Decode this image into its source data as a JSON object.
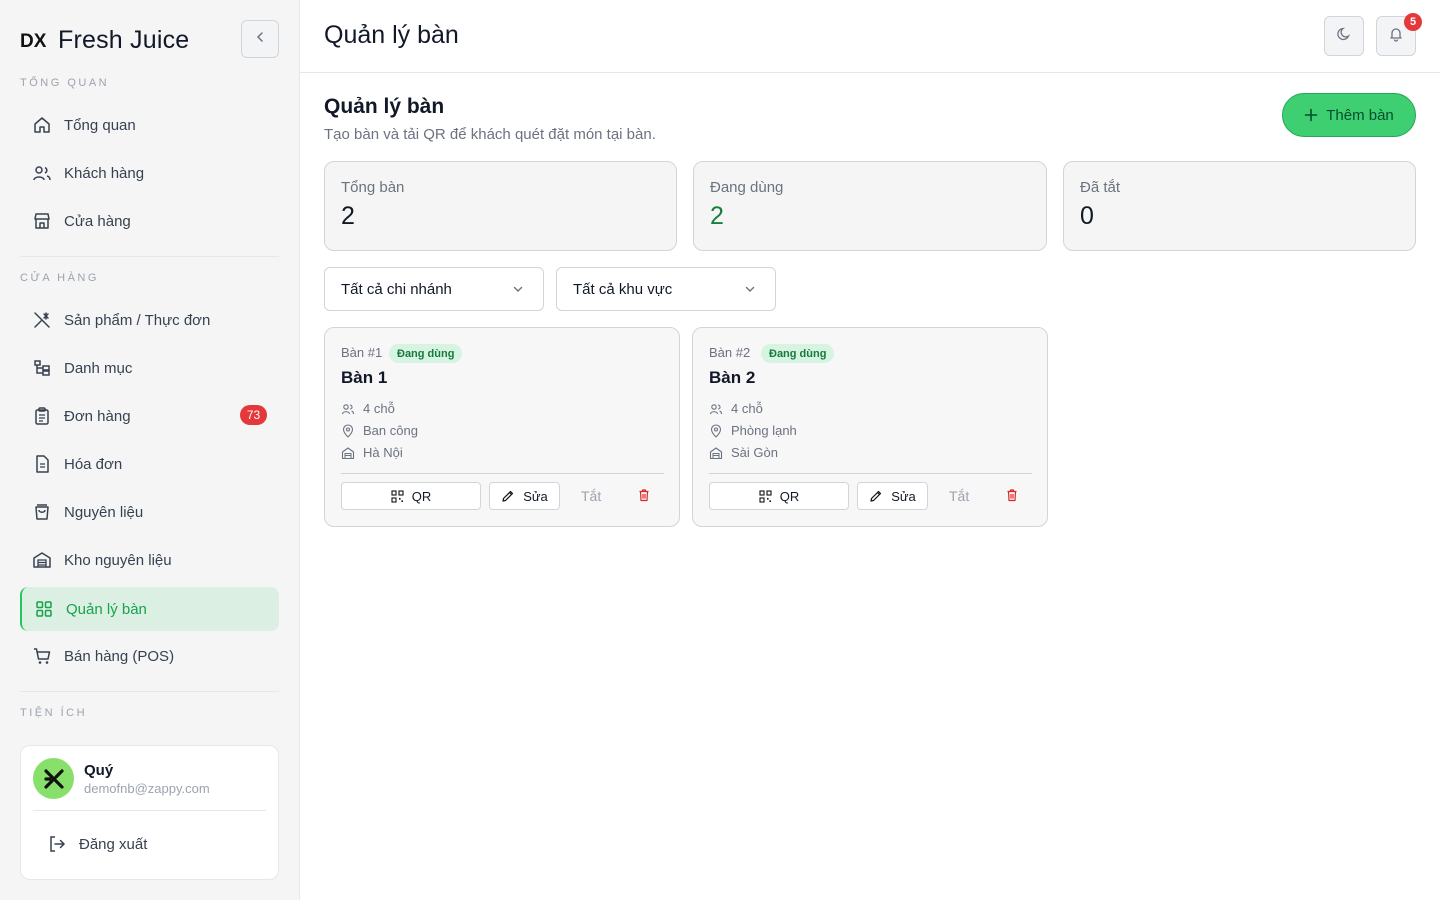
{
  "brand": {
    "name": "Fresh Juice",
    "logo_icon": "dx-logo-icon"
  },
  "sidebar": {
    "section_overview": "TỔNG QUAN",
    "overview_items": [
      {
        "label": "Tổng quan",
        "icon": "home-icon"
      },
      {
        "label": "Khách hàng",
        "icon": "users-icon"
      },
      {
        "label": "Cửa hàng",
        "icon": "store-icon"
      }
    ],
    "section_store": "CỬA HÀNG",
    "store_items": [
      {
        "label": "Sản phẩm / Thực đơn",
        "icon": "utensils-icon"
      },
      {
        "label": "Danh mục",
        "icon": "category-tree-icon"
      },
      {
        "label": "Đơn hàng",
        "icon": "clipboard-icon",
        "badge": "73"
      },
      {
        "label": "Hóa đơn",
        "icon": "invoice-icon"
      },
      {
        "label": "Nguyên liệu",
        "icon": "bag-icon"
      },
      {
        "label": "Kho nguyên liệu",
        "icon": "warehouse-icon"
      },
      {
        "label": "Quản lý bàn",
        "icon": "grid-icon",
        "active": true
      },
      {
        "label": "Bán hàng (POS)",
        "icon": "cart-icon"
      }
    ],
    "section_utilities": "TIỆN ÍCH",
    "user": {
      "name": "Quý",
      "email": "demofnb@zappy.com",
      "logout_label": "Đăng xuất"
    }
  },
  "header": {
    "title": "Quản lý bàn",
    "notification_count": "5"
  },
  "main": {
    "heading": "Quản lý bàn",
    "subtitle": "Tạo bàn và tải QR để khách quét đặt món tại bàn.",
    "add_button": "Thêm bàn",
    "stats": [
      {
        "label": "Tổng bàn",
        "value": "2"
      },
      {
        "label": "Đang dùng",
        "value": "2"
      },
      {
        "label": "Đã tắt",
        "value": "0"
      }
    ],
    "filters": {
      "branch": "Tất cả chi nhánh",
      "area": "Tất cả khu vực"
    },
    "tables": [
      {
        "number": "Bàn #1",
        "status": "Đang dùng",
        "name": "Bàn 1",
        "seats": "4 chỗ",
        "area": "Ban công",
        "branch": "Hà Nội",
        "qr": "QR",
        "edit": "Sửa",
        "off": "Tắt"
      },
      {
        "number": "Bàn #2",
        "status": "Đang dùng",
        "name": "Bàn 2",
        "seats": "4 chỗ",
        "area": "Phòng lạnh",
        "branch": "Sài Gòn",
        "qr": "QR",
        "edit": "Sửa",
        "off": "Tắt"
      }
    ]
  },
  "colors": {
    "accent": "#3ecf73",
    "active_bg": "#dcefe3",
    "active_text": "#16a34a",
    "badge": "#e5383b"
  }
}
